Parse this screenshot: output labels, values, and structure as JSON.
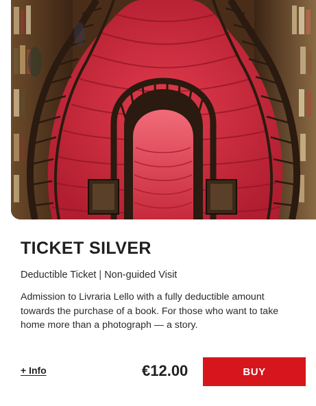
{
  "product": {
    "title": "TICKET SILVER",
    "subtitle_part1": "Deductible Ticket",
    "subtitle_separator": "|",
    "subtitle_part2": "Non-guided Visit",
    "description": "Admission to Livraria Lello with a fully deductible amount towards the purchase of a book. For those who want to take home more than a photograph — a story.",
    "info_label": "+ Info",
    "price": "€12.00",
    "buy_label": "BUY"
  },
  "colors": {
    "accent": "#d7151d",
    "stair_red": "#c8283a",
    "wood_dark": "#2a1a10",
    "text": "#1f1f1f"
  },
  "image": {
    "icon": "staircase-photo"
  }
}
